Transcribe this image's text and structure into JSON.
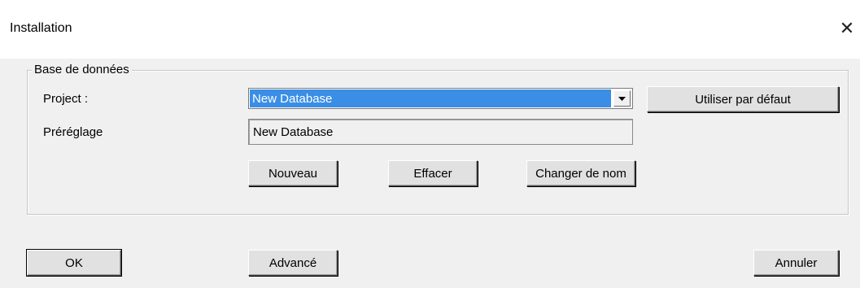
{
  "window": {
    "title": "Installation",
    "close_glyph": "✕",
    "close_icon": "close-icon"
  },
  "group": {
    "legend": "Base de données"
  },
  "project": {
    "label": "Project :",
    "selected_value": "New Database",
    "dropdown_icon": "chevron-down-icon"
  },
  "preset": {
    "label": "Préréglage",
    "value": "New Database"
  },
  "buttons": {
    "use_default": "Utiliser par défaut",
    "new": "Nouveau",
    "delete": "Effacer",
    "rename": "Changer de nom",
    "ok": "OK",
    "advanced": "Advancé",
    "cancel": "Annuler"
  },
  "colors": {
    "selection": "#3a8ee6",
    "dialog_bg": "#f0f0f0",
    "titlebar_bg": "#ffffff"
  }
}
